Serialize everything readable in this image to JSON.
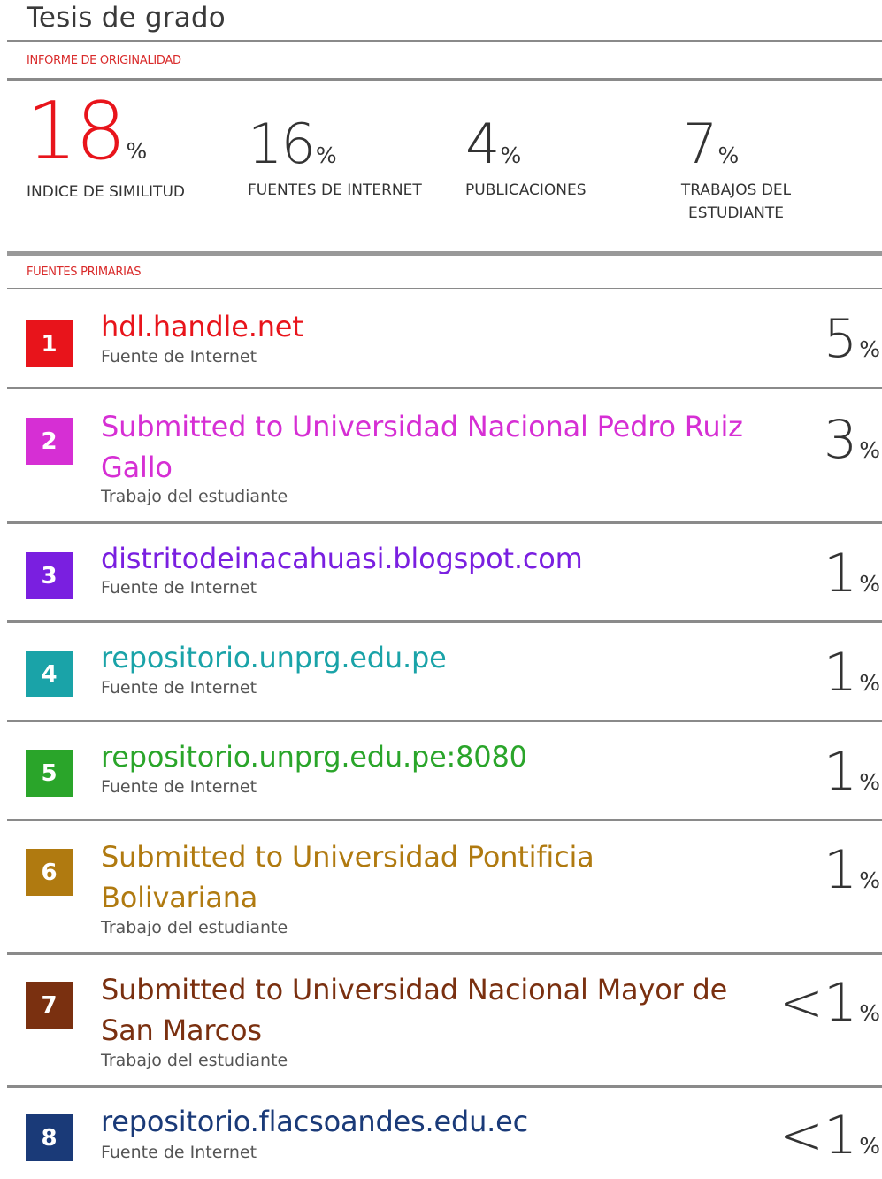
{
  "title": "Tesis de grado",
  "report_label": "INFORME DE ORIGINALIDAD",
  "stats": [
    {
      "value": "18",
      "unit": "%",
      "label": "INDICE DE SIMILITUD"
    },
    {
      "value": "16",
      "unit": "%",
      "label": "FUENTES DE INTERNET"
    },
    {
      "value": "4",
      "unit": "%",
      "label": "PUBLICACIONES"
    },
    {
      "value": "7",
      "unit": "%",
      "label": "TRABAJOS DEL ESTUDIANTE"
    }
  ],
  "primary_label": "FUENTES PRIMARIAS",
  "sources": [
    {
      "num": "1",
      "name": "hdl.handle.net",
      "type": "Fuente de Internet",
      "pct": "5",
      "unit": "%",
      "color": "#e8141b"
    },
    {
      "num": "2",
      "name": "Submitted to Universidad Nacional Pedro Ruiz Gallo",
      "type": "Trabajo del estudiante",
      "pct": "3",
      "unit": "%",
      "color": "#d62fd4"
    },
    {
      "num": "3",
      "name": "distritodeinacahuasi.blogspot.com",
      "type": "Fuente de Internet",
      "pct": "1",
      "unit": "%",
      "color": "#7a1fe0"
    },
    {
      "num": "4",
      "name": "repositorio.unprg.edu.pe",
      "type": "Fuente de Internet",
      "pct": "1",
      "unit": "%",
      "color": "#1aa3a8"
    },
    {
      "num": "5",
      "name": "repositorio.unprg.edu.pe:8080",
      "type": "Fuente de Internet",
      "pct": "1",
      "unit": "%",
      "color": "#2aa52a"
    },
    {
      "num": "6",
      "name": "Submitted to Universidad Pontificia Bolivariana",
      "type": "Trabajo del estudiante",
      "pct": "1",
      "unit": "%",
      "color": "#b07a10"
    },
    {
      "num": "7",
      "name": "Submitted to Universidad Nacional Mayor de San Marcos",
      "type": "Trabajo del estudiante",
      "pct": "<1",
      "unit": "%",
      "color": "#7a3010"
    },
    {
      "num": "8",
      "name": "repositorio.flacsoandes.edu.ec",
      "type": "Fuente de Internet",
      "pct": "<1",
      "unit": "%",
      "color": "#1a3a78"
    }
  ]
}
